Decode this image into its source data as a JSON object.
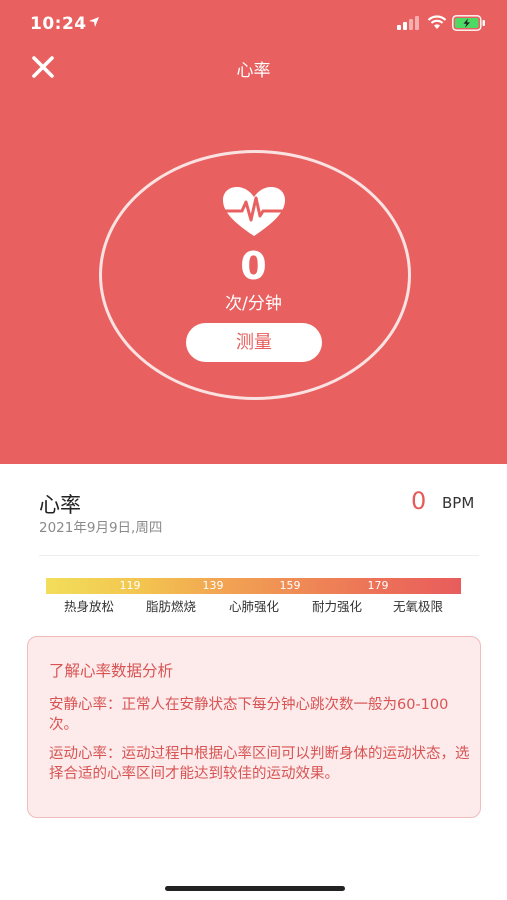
{
  "status_bar": {
    "time": "10:24",
    "icons": [
      "location-arrow-icon",
      "signal-icon",
      "wifi-icon",
      "battery-charging-icon"
    ]
  },
  "nav": {
    "title": "心率",
    "close_icon": "close-icon"
  },
  "measure": {
    "value": "0",
    "unit": "次/分钟",
    "button_label": "测量",
    "icon": "heart-pulse-icon"
  },
  "record": {
    "title": "心率",
    "date": "2021年9月9日,周四",
    "value": "0",
    "unit": "BPM"
  },
  "zones": {
    "ticks": [
      "119",
      "139",
      "159",
      "179"
    ],
    "labels": [
      "热身放松",
      "脂肪燃烧",
      "心肺强化",
      "耐力强化",
      "无氧极限"
    ],
    "gradient_colors": [
      "#f2de5a",
      "#f2a552",
      "#e85c5c"
    ]
  },
  "info": {
    "title": "了解心率数据分析",
    "resting": "安静心率：正常人在安静状态下每分钟心跳次数一般为60-100次。",
    "exercise": "运动心率：运动过程中根据心率区间可以判断身体的运动状态，选择合适的心率区间才能达到较佳的运动效果。"
  },
  "colors": {
    "primary": "#e8605f",
    "accent_text": "#d85454",
    "card_bg": "#fdeaea",
    "card_border": "#f1bcbc"
  }
}
